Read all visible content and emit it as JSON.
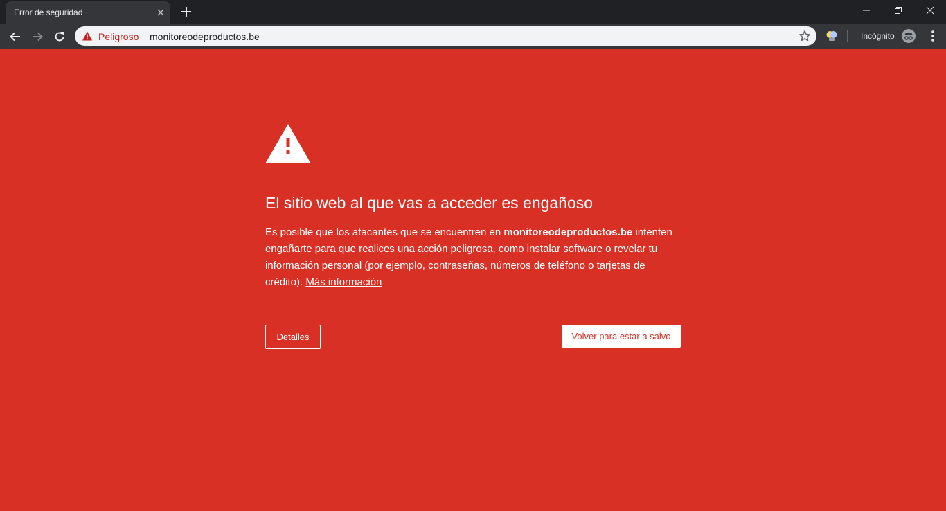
{
  "browser": {
    "tab": {
      "title": "Error de seguridad"
    },
    "omnibox": {
      "security_label": "Peligroso",
      "url": "monitoreodeproductos.be"
    },
    "incognito_label": "Incógnito",
    "icons": {
      "tab_close": "close-icon",
      "new_tab": "plus-icon",
      "back": "arrow-left-icon",
      "forward": "arrow-right-icon",
      "reload": "reload-icon",
      "security": "warning-triangle-icon",
      "bookmark": "star-icon",
      "extension": "lightbulb-icon",
      "incognito": "incognito-icon",
      "menu": "more-vert-icon",
      "minimize": "minimize-icon",
      "restore": "restore-icon",
      "close_window": "close-icon"
    }
  },
  "interstitial": {
    "heading": "El sitio web al que vas a acceder es engañoso",
    "body_before": "Es posible que los atacantes que se encuentren en ",
    "body_site": "monitoreodeproductos.be",
    "body_after": " intenten engañarte para que realices una acción peligrosa, como instalar software o revelar tu información personal (por ejemplo, contraseñas, números de teléfono o tarjetas de crédito). ",
    "learn_more": "Más información",
    "details_button": "Detalles",
    "back_button": "Volver para estar a salvo"
  },
  "colors": {
    "danger_red": "#d93025",
    "chrome_dark": "#202124",
    "toolbar": "#35363a",
    "omnibox_bg": "#f1f3f4",
    "danger_text": "#c5221f"
  }
}
